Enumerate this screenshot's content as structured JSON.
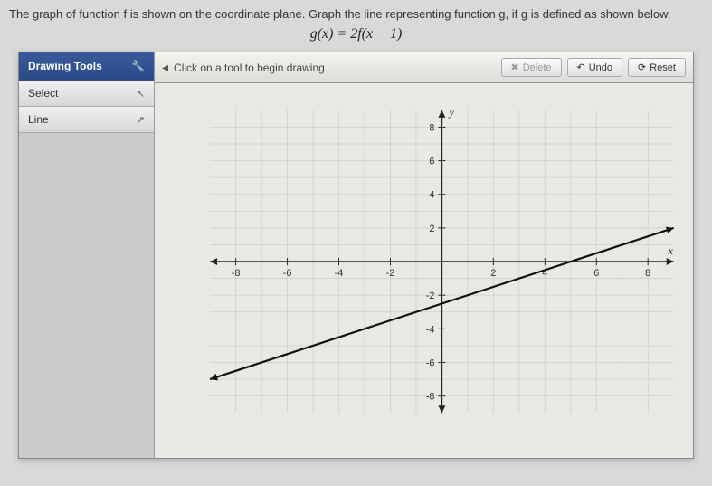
{
  "instruction": "The graph of function f is shown on the coordinate plane. Graph the line representing function g, if g is defined as shown below.",
  "formula": "g(x) = 2f(x − 1)",
  "sidebar": {
    "header": "Drawing Tools",
    "items": [
      {
        "label": "Select"
      },
      {
        "label": "Line"
      }
    ]
  },
  "topbar": {
    "hint": "Click on a tool to begin drawing.",
    "buttons": {
      "delete": "Delete",
      "undo": "Undo",
      "reset": "Reset"
    }
  },
  "chart_data": {
    "type": "line",
    "title": "",
    "xlabel": "x",
    "ylabel": "y",
    "xlim": [
      -9,
      9
    ],
    "ylim": [
      -9,
      9
    ],
    "xticks": [
      -8,
      -6,
      -4,
      -2,
      2,
      4,
      6,
      8
    ],
    "yticks": [
      -8,
      -6,
      -4,
      -2,
      2,
      4,
      6,
      8
    ],
    "series": [
      {
        "name": "f",
        "points": [
          {
            "x": -9,
            "y": -7
          },
          {
            "x": 9,
            "y": 2
          }
        ],
        "note": "line with slope 0.5, y-intercept -2.5"
      }
    ]
  }
}
